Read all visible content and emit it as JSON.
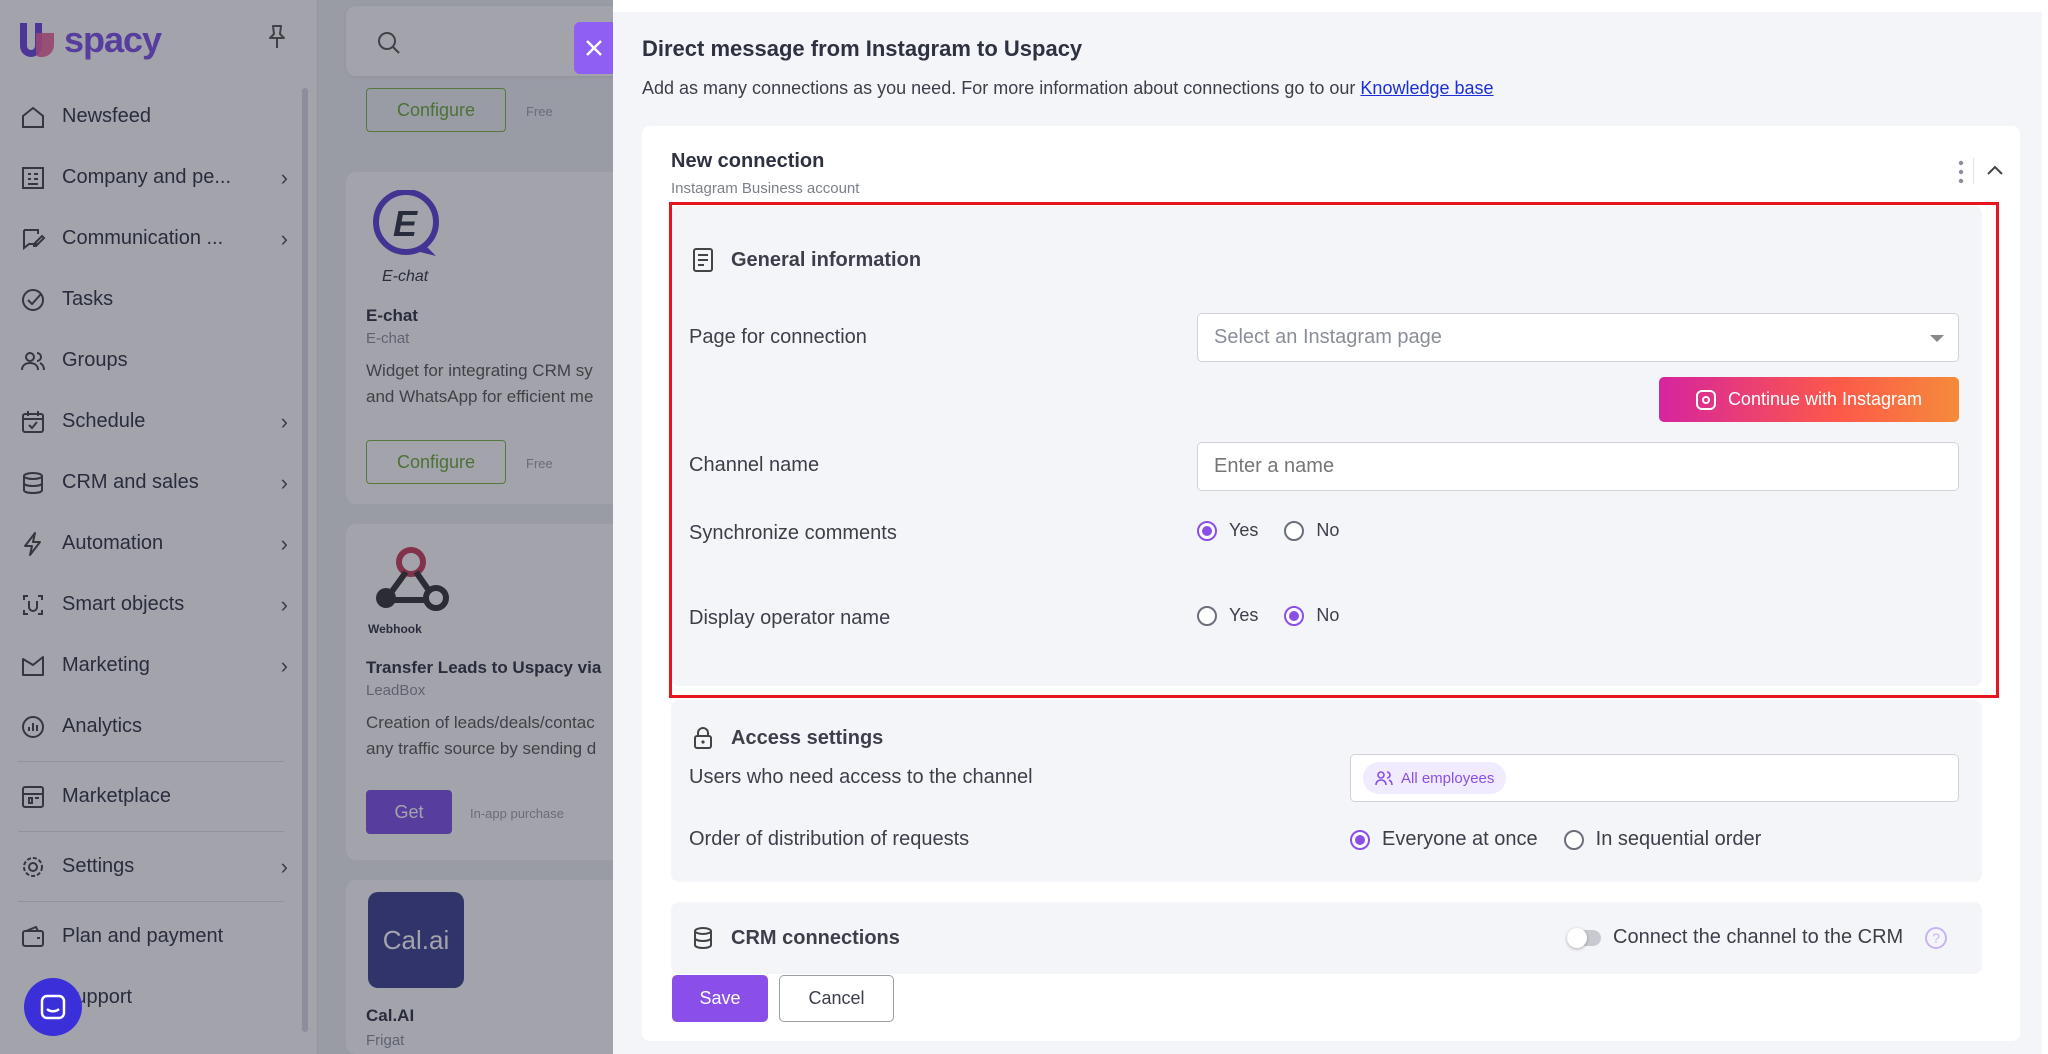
{
  "sidebar": {
    "logo_text": "spacy",
    "items": [
      {
        "label": "Newsfeed",
        "icon": "home-icon",
        "chevron": false
      },
      {
        "label": "Company and pe...",
        "icon": "building-icon",
        "chevron": true
      },
      {
        "label": "Communication ...",
        "icon": "chat-edit-icon",
        "chevron": true
      },
      {
        "label": "Tasks",
        "icon": "check-circle-icon",
        "chevron": false
      },
      {
        "label": "Groups",
        "icon": "users-icon",
        "chevron": false
      },
      {
        "label": "Schedule",
        "icon": "calendar-icon",
        "chevron": true
      },
      {
        "label": "CRM and sales",
        "icon": "database-icon",
        "chevron": true
      },
      {
        "label": "Automation",
        "icon": "lightning-icon",
        "chevron": true
      },
      {
        "label": "Smart objects",
        "icon": "smart-object-icon",
        "chevron": true
      },
      {
        "label": "Marketing",
        "icon": "marketing-icon",
        "chevron": true
      },
      {
        "label": "Analytics",
        "icon": "chart-icon",
        "chevron": false
      },
      {
        "label": "Marketplace",
        "icon": "store-icon",
        "chevron": false
      },
      {
        "label": "Settings",
        "icon": "gear-icon",
        "chevron": true
      },
      {
        "label": "Plan and payment",
        "icon": "wallet-icon",
        "chevron": false
      },
      {
        "label": "Support",
        "icon": "support-icon",
        "chevron": false
      }
    ]
  },
  "marketplace": {
    "card0": {
      "button": "Configure",
      "price": "Free"
    },
    "card1": {
      "logo_text": "E-chat",
      "title": "E-chat",
      "sub": "E-chat",
      "desc1": "Widget for integrating CRM sy",
      "desc2": "and WhatsApp for efficient me",
      "button": "Configure",
      "price": "Free"
    },
    "card2": {
      "logo_text": "Webhook",
      "title": "Transfer Leads to Uspacy via",
      "sub": "LeadBox",
      "desc1": "Creation of leads/deals/contac",
      "desc2": "any traffic source by sending d",
      "button": "Get",
      "price": "In-app purchase"
    },
    "card3": {
      "logo_text": "Cal.ai",
      "title": "Cal.AI",
      "sub": "Frigat"
    }
  },
  "panel": {
    "title": "Direct message from Instagram to Uspacy",
    "desc": "Add as many connections as you need. For more information about connections go to our ",
    "desc_link": "Knowledge base",
    "connection": {
      "title": "New connection",
      "subtitle": "Instagram Business account"
    },
    "general": {
      "heading": "General information",
      "page_label": "Page for connection",
      "page_placeholder": "Select an Instagram page",
      "ig_button": "Continue with Instagram",
      "channel_label": "Channel name",
      "channel_placeholder": "Enter a name",
      "sync_label": "Synchronize comments",
      "sync_yes": "Yes",
      "sync_no": "No",
      "operator_label": "Display operator name",
      "operator_yes": "Yes",
      "operator_no": "No"
    },
    "access": {
      "heading": "Access settings",
      "users_label": "Users who need access to the channel",
      "users_chip": "All employees",
      "order_label": "Order of distribution of requests",
      "order_opt1": "Everyone at once",
      "order_opt2": "In sequential order"
    },
    "crm": {
      "heading": "CRM connections",
      "toggle_label": "Connect the channel to the CRM",
      "help": "?"
    },
    "save": "Save",
    "cancel": "Cancel"
  },
  "colors": {
    "accent": "#8a4fe8",
    "highlight": "#e5161d",
    "instagram_start": "#d6249f",
    "instagram_end": "#f58b3b"
  }
}
